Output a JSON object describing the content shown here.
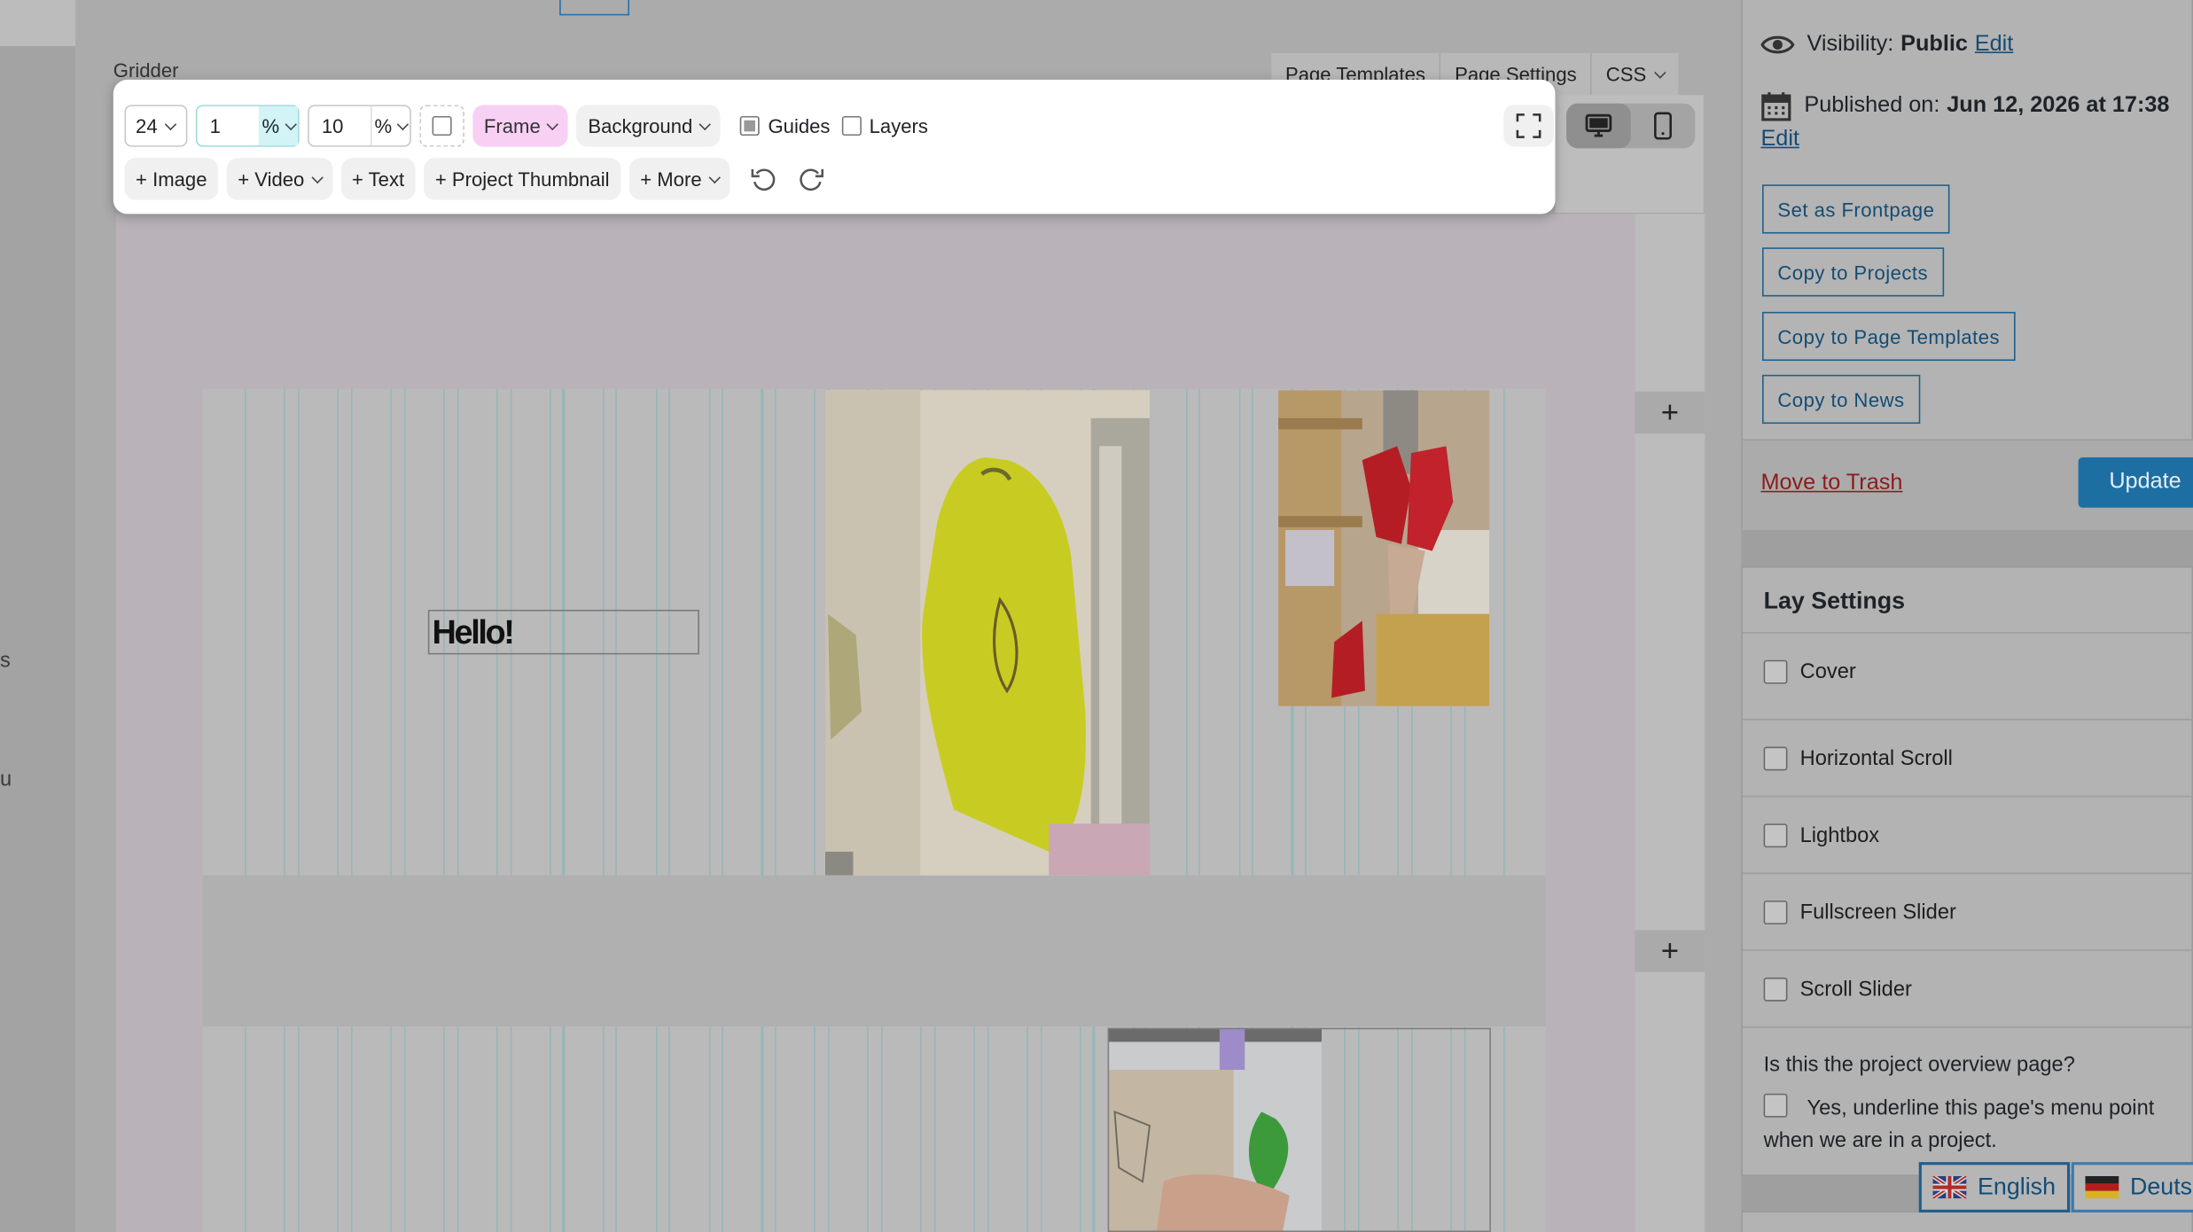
{
  "editor": {
    "title": "Gridder",
    "tabs": [
      "Page Templates",
      "Page Settings",
      "CSS"
    ],
    "toolbar": {
      "columns": "24",
      "gutter_value": "1",
      "gutter_unit": "%",
      "frame_value": "10",
      "frame_unit": "%",
      "frame_label": "Frame",
      "background_label": "Background",
      "guides_label": "Guides",
      "guides_checked": true,
      "layers_label": "Layers",
      "layers_checked": false,
      "add_buttons": [
        "+ Image",
        "+ Video",
        "+ Text",
        "+ Project Thumbnail",
        "+ More"
      ]
    },
    "canvas": {
      "text_element": "Hello!",
      "plus_label": "+"
    },
    "left_cut_text": [
      "s",
      "u"
    ]
  },
  "publish": {
    "visibility_label": "Visibility:",
    "visibility_value": "Public",
    "edit_link": "Edit",
    "published_label": "Published on:",
    "published_value": "Jun 12, 2026 at 17:38",
    "published_edit": "Edit",
    "buttons": [
      "Set as Frontpage",
      "Copy to Projects",
      "Copy to Page Templates",
      "Copy to News"
    ],
    "trash_label": "Move to Trash",
    "update_label": "Update"
  },
  "lay_settings": {
    "title": "Lay Settings",
    "options": [
      "Cover",
      "Horizontal Scroll",
      "Lightbox",
      "Fullscreen Slider",
      "Scroll Slider"
    ],
    "question": "Is this the project overview page?",
    "overview_option": "Yes, underline this page's menu point when we are in a project."
  },
  "languages": [
    "English",
    "Deutsch"
  ],
  "colors": {
    "accent": "#2271b1",
    "update_button": "#1d6fa3",
    "frame_pill": "#f8d0f4",
    "gutter_field": "#d2f4f6"
  }
}
